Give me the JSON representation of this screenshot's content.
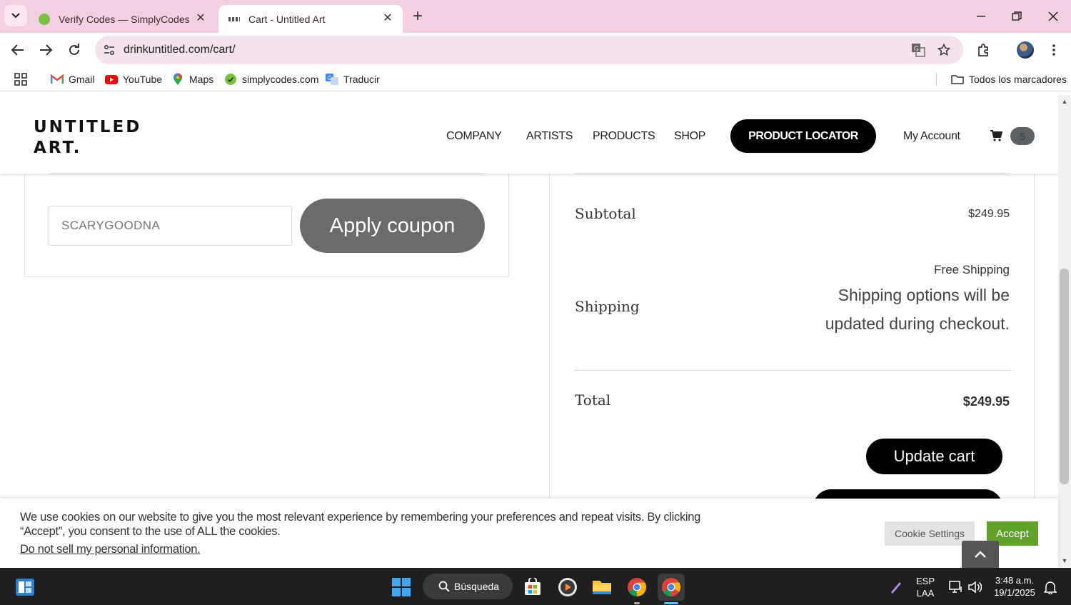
{
  "browser": {
    "tabs": [
      {
        "title": "Verify Codes — SimplyCodes",
        "active": false
      },
      {
        "title": "Cart - Untitled Art",
        "active": true
      }
    ],
    "url": "drinkuntitled.com/cart/",
    "bookmarks": [
      {
        "label": "Gmail",
        "icon": "gmail-icon"
      },
      {
        "label": "YouTube",
        "icon": "youtube-icon"
      },
      {
        "label": "Maps",
        "icon": "maps-icon"
      },
      {
        "label": "simplycodes.com",
        "icon": "simplycodes-icon"
      },
      {
        "label": "Traducir",
        "icon": "translate-icon"
      }
    ],
    "all_bookmarks": "Todos los marcadores"
  },
  "site": {
    "logo_line1": "UNTITLED",
    "logo_line2": "ART.",
    "nav": [
      "COMPANY",
      "ARTISTS",
      "PRODUCTS",
      "SHOP"
    ],
    "locator_label": "PRODUCT LOCATOR",
    "account_label": "My Account",
    "cart_count": "5"
  },
  "coupon": {
    "placeholder": "SCARYGOODNA",
    "apply_label": "Apply coupon"
  },
  "totals": {
    "subtotal_label": "Subtotal",
    "subtotal_value": "$249.95",
    "shipping_label": "Shipping",
    "shipping_method": "Free Shipping",
    "shipping_note": "Shipping options will be updated during checkout.",
    "total_label": "Total",
    "total_value": "$249.95",
    "update_label": "Update cart"
  },
  "cookie": {
    "text": "We use cookies on our website to give you the most relevant experience by remembering your preferences and repeat visits. By clicking “Accept”, you consent to the use of ALL the cookies.",
    "link": "Do not sell my personal information.",
    "settings_label": "Cookie Settings",
    "accept_label": "Accept"
  },
  "taskbar": {
    "search_label": "Búsqueda",
    "lang_line1": "ESP",
    "lang_line2": "LAA",
    "time": "3:48 a.m.",
    "date": "19/1/2025"
  },
  "colors": {
    "tabbar": "#f3cfe3",
    "accept_green": "#61a229",
    "apply_gray": "#6b6b6b"
  }
}
